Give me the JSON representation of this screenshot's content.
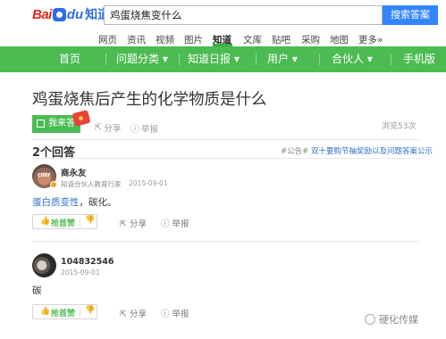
{
  "header": {
    "logo_brand": "Bai",
    "logo_du": "du",
    "logo_product": "知道",
    "search_value": "鸡蛋烧焦变什么",
    "search_button": "搜索答案"
  },
  "nav": [
    {
      "label": "网页"
    },
    {
      "label": "资讯"
    },
    {
      "label": "视频"
    },
    {
      "label": "图片"
    },
    {
      "label": "知道"
    },
    {
      "label": "文库"
    },
    {
      "label": "贴吧"
    },
    {
      "label": "采购"
    },
    {
      "label": "地图"
    },
    {
      "label": "更多»"
    }
  ],
  "greenbar": [
    {
      "label": "首页"
    },
    {
      "label": "问题分类 ▾"
    },
    {
      "label": "知道日报 ▾"
    },
    {
      "label": "用户 ▾"
    },
    {
      "label": "合伙人 ▾"
    },
    {
      "label": "手机版"
    }
  ],
  "question": {
    "title": "鸡蛋烧焦后产生的化学物质是什么",
    "answer_button": "我来答",
    "share": "分享",
    "report": "举报",
    "views": "浏览53次"
  },
  "answers_header": {
    "count": "2个回答",
    "notice_prefix": "#公告#",
    "notice_link": "双十要购节抽奖励以及问题答案公示"
  },
  "answers": [
    {
      "name": "商永友",
      "subtitle": "知道合伙人教育行家",
      "date": "2015-09-01",
      "body_highlight": "蛋白质变性",
      "body_rest": "，碳化。",
      "vote_label": "抢首赞",
      "share": "分享",
      "report": "举报"
    },
    {
      "name": "104832546",
      "date": "2015-09-01",
      "body_rest": "碳",
      "vote_label": "抢首赞",
      "share": "分享",
      "report": "举报"
    }
  ],
  "watermark": "硬化传媒",
  "colors": {
    "accent_green": "#4cbb52",
    "search_blue": "#3385ff",
    "link_blue": "#2f70c5"
  }
}
